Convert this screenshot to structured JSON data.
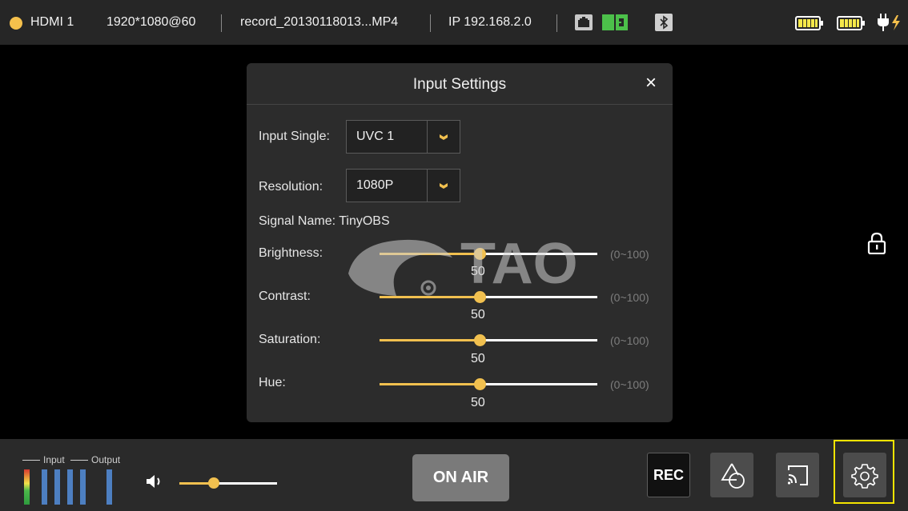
{
  "status_bar": {
    "source": "HDMI 1",
    "format": "1920*1080@60",
    "record_file": "record_20130118013...MP4",
    "ip": "IP 192.168.2.0",
    "source_indicator_color": "#f5c04c",
    "icons": [
      "ethernet-icon",
      "sim-card-icon",
      "bluetooth-icon",
      "battery-icon",
      "battery-icon",
      "power-plug-icon"
    ]
  },
  "dialog": {
    "title": "Input Settings",
    "close_label": "×",
    "input_single": {
      "label": "Input Single:",
      "value": "UVC 1"
    },
    "resolution": {
      "label": "Resolution:",
      "value": "1080P"
    },
    "signal_name": {
      "label": "Signal Name:",
      "value": "TinyOBS"
    },
    "sliders": [
      {
        "label": "Brightness:",
        "value": "50",
        "range": "(0~100)",
        "level": 0.46
      },
      {
        "label": "Contrast:",
        "value": "50",
        "range": "(0~100)",
        "level": 0.46
      },
      {
        "label": "Saturation:",
        "value": "50",
        "range": "(0~100)",
        "level": 0.46
      },
      {
        "label": "Hue:",
        "value": "50",
        "range": "(0~100)",
        "level": 0.46
      }
    ]
  },
  "watermark": {
    "text": "TAO"
  },
  "bottom_bar": {
    "legend_input": "Input",
    "legend_output": "Output",
    "volume_level": 0.35,
    "on_air_label": "ON AIR",
    "rec_label": "REC",
    "accent_color": "#f1c04f",
    "highlight_color": "#f4e400"
  }
}
